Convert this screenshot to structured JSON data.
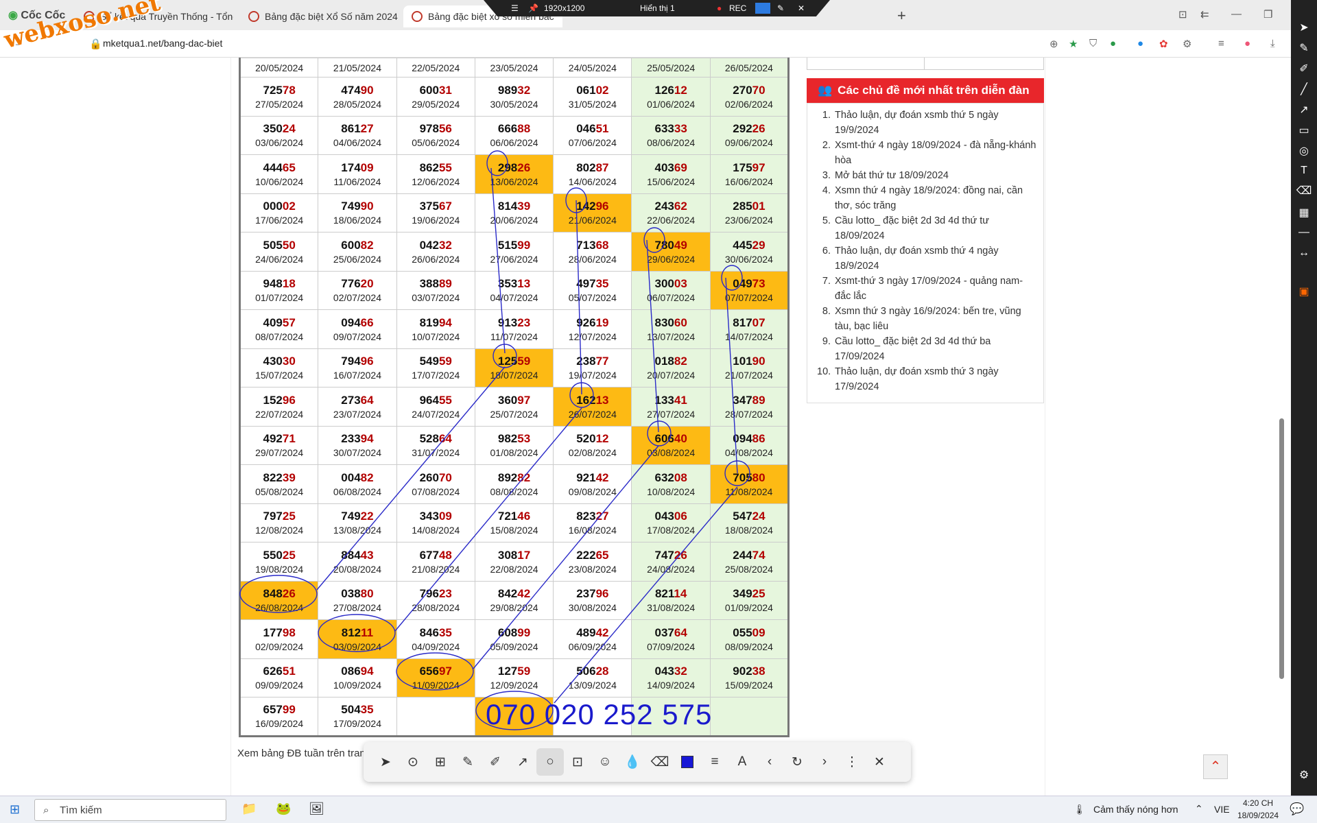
{
  "browser": {
    "logo": "Cốc Cốc",
    "tabs": [
      {
        "label": "Sổ kết quả Truyền Thống - Tổng",
        "active": false
      },
      {
        "label": "Bảng đặc biệt Xổ Số năm 2024",
        "active": false
      },
      {
        "label": "Bảng đặc biệt xổ số miền bắc",
        "active": true
      }
    ],
    "url": "mketqua1.net/bang-dac-biet",
    "recorder": {
      "resolution": "1920x1200",
      "display": "Hiển thị 1",
      "rec": "REC"
    }
  },
  "watermark": "webxoso.net",
  "table": {
    "rows": [
      [
        [
          "",
          "",
          "20/05/2024",
          0
        ],
        [
          "",
          "",
          "21/05/2024",
          0
        ],
        [
          "",
          "",
          "22/05/2024",
          0
        ],
        [
          "",
          "",
          "23/05/2024",
          0
        ],
        [
          "",
          "",
          "24/05/2024",
          0
        ],
        [
          "",
          "",
          "25/05/2024",
          0
        ],
        [
          "",
          "",
          "26/05/2024",
          0
        ]
      ],
      [
        [
          "725",
          "78",
          "27/05/2024",
          0
        ],
        [
          "474",
          "90",
          "28/05/2024",
          0
        ],
        [
          "600",
          "31",
          "29/05/2024",
          0
        ],
        [
          "989",
          "32",
          "30/05/2024",
          0
        ],
        [
          "061",
          "02",
          "31/05/2024",
          0
        ],
        [
          "126",
          "12",
          "01/06/2024",
          0
        ],
        [
          "270",
          "70",
          "02/06/2024",
          0
        ]
      ],
      [
        [
          "350",
          "24",
          "03/06/2024",
          0
        ],
        [
          "861",
          "27",
          "04/06/2024",
          0
        ],
        [
          "978",
          "56",
          "05/06/2024",
          0
        ],
        [
          "666",
          "88",
          "06/06/2024",
          0
        ],
        [
          "046",
          "51",
          "07/06/2024",
          0
        ],
        [
          "633",
          "33",
          "08/06/2024",
          0
        ],
        [
          "292",
          "26",
          "09/06/2024",
          0
        ]
      ],
      [
        [
          "444",
          "65",
          "10/06/2024",
          0
        ],
        [
          "174",
          "09",
          "11/06/2024",
          0
        ],
        [
          "862",
          "55",
          "12/06/2024",
          0
        ],
        [
          "298",
          "26",
          "13/06/2024",
          1
        ],
        [
          "802",
          "87",
          "14/06/2024",
          0
        ],
        [
          "403",
          "69",
          "15/06/2024",
          0
        ],
        [
          "175",
          "97",
          "16/06/2024",
          0
        ]
      ],
      [
        [
          "000",
          "02",
          "17/06/2024",
          0
        ],
        [
          "749",
          "90",
          "18/06/2024",
          0
        ],
        [
          "375",
          "67",
          "19/06/2024",
          0
        ],
        [
          "814",
          "39",
          "20/06/2024",
          0
        ],
        [
          "142",
          "96",
          "21/06/2024",
          1
        ],
        [
          "243",
          "62",
          "22/06/2024",
          0
        ],
        [
          "285",
          "01",
          "23/06/2024",
          0
        ]
      ],
      [
        [
          "505",
          "50",
          "24/06/2024",
          0
        ],
        [
          "600",
          "82",
          "25/06/2024",
          0
        ],
        [
          "042",
          "32",
          "26/06/2024",
          0
        ],
        [
          "515",
          "99",
          "27/06/2024",
          0
        ],
        [
          "713",
          "68",
          "28/06/2024",
          0
        ],
        [
          "780",
          "49",
          "29/06/2024",
          1
        ],
        [
          "445",
          "29",
          "30/06/2024",
          0
        ]
      ],
      [
        [
          "948",
          "18",
          "01/07/2024",
          0
        ],
        [
          "776",
          "20",
          "02/07/2024",
          0
        ],
        [
          "388",
          "89",
          "03/07/2024",
          0
        ],
        [
          "353",
          "13",
          "04/07/2024",
          0
        ],
        [
          "497",
          "35",
          "05/07/2024",
          0
        ],
        [
          "300",
          "03",
          "06/07/2024",
          0
        ],
        [
          "049",
          "73",
          "07/07/2024",
          1
        ]
      ],
      [
        [
          "409",
          "57",
          "08/07/2024",
          0
        ],
        [
          "094",
          "66",
          "09/07/2024",
          0
        ],
        [
          "819",
          "94",
          "10/07/2024",
          0
        ],
        [
          "913",
          "23",
          "11/07/2024",
          0
        ],
        [
          "926",
          "19",
          "12/07/2024",
          0
        ],
        [
          "830",
          "60",
          "13/07/2024",
          0
        ],
        [
          "817",
          "07",
          "14/07/2024",
          0
        ]
      ],
      [
        [
          "430",
          "30",
          "15/07/2024",
          0
        ],
        [
          "794",
          "96",
          "16/07/2024",
          0
        ],
        [
          "549",
          "59",
          "17/07/2024",
          0
        ],
        [
          "125",
          "59",
          "18/07/2024",
          1
        ],
        [
          "238",
          "77",
          "19/07/2024",
          0
        ],
        [
          "018",
          "82",
          "20/07/2024",
          0
        ],
        [
          "101",
          "90",
          "21/07/2024",
          0
        ]
      ],
      [
        [
          "152",
          "96",
          "22/07/2024",
          0
        ],
        [
          "273",
          "64",
          "23/07/2024",
          0
        ],
        [
          "964",
          "55",
          "24/07/2024",
          0
        ],
        [
          "360",
          "97",
          "25/07/2024",
          0
        ],
        [
          "162",
          "13",
          "26/07/2024",
          1
        ],
        [
          "133",
          "41",
          "27/07/2024",
          0
        ],
        [
          "347",
          "89",
          "28/07/2024",
          0
        ]
      ],
      [
        [
          "492",
          "71",
          "29/07/2024",
          0
        ],
        [
          "233",
          "94",
          "30/07/2024",
          0
        ],
        [
          "528",
          "64",
          "31/07/2024",
          0
        ],
        [
          "982",
          "53",
          "01/08/2024",
          0
        ],
        [
          "520",
          "12",
          "02/08/2024",
          0
        ],
        [
          "606",
          "40",
          "03/08/2024",
          1
        ],
        [
          "094",
          "86",
          "04/08/2024",
          0
        ]
      ],
      [
        [
          "822",
          "39",
          "05/08/2024",
          0
        ],
        [
          "004",
          "82",
          "06/08/2024",
          0
        ],
        [
          "260",
          "70",
          "07/08/2024",
          0
        ],
        [
          "892",
          "82",
          "08/08/2024",
          0
        ],
        [
          "921",
          "42",
          "09/08/2024",
          0
        ],
        [
          "632",
          "08",
          "10/08/2024",
          0
        ],
        [
          "705",
          "80",
          "11/08/2024",
          1
        ]
      ],
      [
        [
          "797",
          "25",
          "12/08/2024",
          0
        ],
        [
          "749",
          "22",
          "13/08/2024",
          0
        ],
        [
          "343",
          "09",
          "14/08/2024",
          0
        ],
        [
          "721",
          "46",
          "15/08/2024",
          0
        ],
        [
          "823",
          "27",
          "16/08/2024",
          0
        ],
        [
          "043",
          "06",
          "17/08/2024",
          0
        ],
        [
          "547",
          "24",
          "18/08/2024",
          0
        ]
      ],
      [
        [
          "550",
          "25",
          "19/08/2024",
          0
        ],
        [
          "884",
          "43",
          "20/08/2024",
          0
        ],
        [
          "677",
          "48",
          "21/08/2024",
          0
        ],
        [
          "308",
          "17",
          "22/08/2024",
          0
        ],
        [
          "222",
          "65",
          "23/08/2024",
          0
        ],
        [
          "747",
          "26",
          "24/08/2024",
          0
        ],
        [
          "244",
          "74",
          "25/08/2024",
          0
        ]
      ],
      [
        [
          "848",
          "26",
          "26/08/2024",
          1
        ],
        [
          "038",
          "80",
          "27/08/2024",
          0
        ],
        [
          "796",
          "23",
          "28/08/2024",
          0
        ],
        [
          "842",
          "42",
          "29/08/2024",
          0
        ],
        [
          "237",
          "96",
          "30/08/2024",
          0
        ],
        [
          "821",
          "14",
          "31/08/2024",
          0
        ],
        [
          "349",
          "25",
          "01/09/2024",
          0
        ]
      ],
      [
        [
          "177",
          "98",
          "02/09/2024",
          0
        ],
        [
          "812",
          "11",
          "03/09/2024",
          1
        ],
        [
          "846",
          "35",
          "04/09/2024",
          0
        ],
        [
          "608",
          "99",
          "05/09/2024",
          0
        ],
        [
          "489",
          "42",
          "06/09/2024",
          0
        ],
        [
          "037",
          "64",
          "07/09/2024",
          0
        ],
        [
          "055",
          "09",
          "08/09/2024",
          0
        ]
      ],
      [
        [
          "626",
          "51",
          "09/09/2024",
          0
        ],
        [
          "086",
          "94",
          "10/09/2024",
          0
        ],
        [
          "656",
          "97",
          "11/09/2024",
          1
        ],
        [
          "127",
          "59",
          "12/09/2024",
          0
        ],
        [
          "506",
          "28",
          "13/09/2024",
          0
        ],
        [
          "043",
          "32",
          "14/09/2024",
          0
        ],
        [
          "902",
          "38",
          "15/09/2024",
          0
        ]
      ],
      [
        [
          "657",
          "99",
          "16/09/2024",
          0
        ],
        [
          "504",
          "35",
          "17/09/2024",
          0
        ],
        [
          "",
          "",
          "",
          0
        ],
        [
          "",
          "",
          "",
          1
        ],
        [
          "",
          "",
          "",
          0
        ],
        [
          "",
          "",
          "",
          0
        ],
        [
          "",
          "",
          "",
          0
        ]
      ]
    ]
  },
  "annotation": {
    "phone": "070 020 252 575",
    "color": "#1a1acc"
  },
  "sidebar": {
    "forum_title": "Các chủ đề mới nhất trên diễn đàn",
    "forum_items": [
      "Thảo luận, dự đoán xsmb thứ 5 ngày 19/9/2024",
      "Xsmt-thứ 4 ngày 18/09/2024 - đà nẵng-khánh hòa",
      "Mở bát thứ tư 18/09/2024",
      "Xsmn thứ 4 ngày 18/9/2024: đồng nai, cần thơ, sóc trăng",
      "Cầu lotto_ đặc biệt 2d 3d 4d thứ tư 18/09/2024",
      "Thảo luận, dự đoán xsmb thứ 4 ngày 18/9/2024",
      "Xsmt-thứ 3 ngày 17/09/2024 - quảng nam-đắc lắc",
      "Xsmn thứ 3 ngày 16/9/2024: bến tre, vũng tàu, bạc liêu",
      "Cầu lotto_ đặc biệt 2d 3d 4d thứ ba 17/09/2024",
      "Thảo luận, dự đoán xsmb thứ 3 ngày 17/9/2024"
    ]
  },
  "footer_text": "Xem bảng ĐB tuần trên trang",
  "colors": {
    "highlight": "#fdba14",
    "weekend": "#e6f6dd",
    "forum_header": "#e8262b",
    "tail_digits": "#b30000"
  },
  "taskbar": {
    "search": "Tìm kiếm",
    "weather": "Cảm thấy nóng hơn",
    "lang": "VIE",
    "time": "4:20 CH",
    "date": "18/09/2024"
  }
}
